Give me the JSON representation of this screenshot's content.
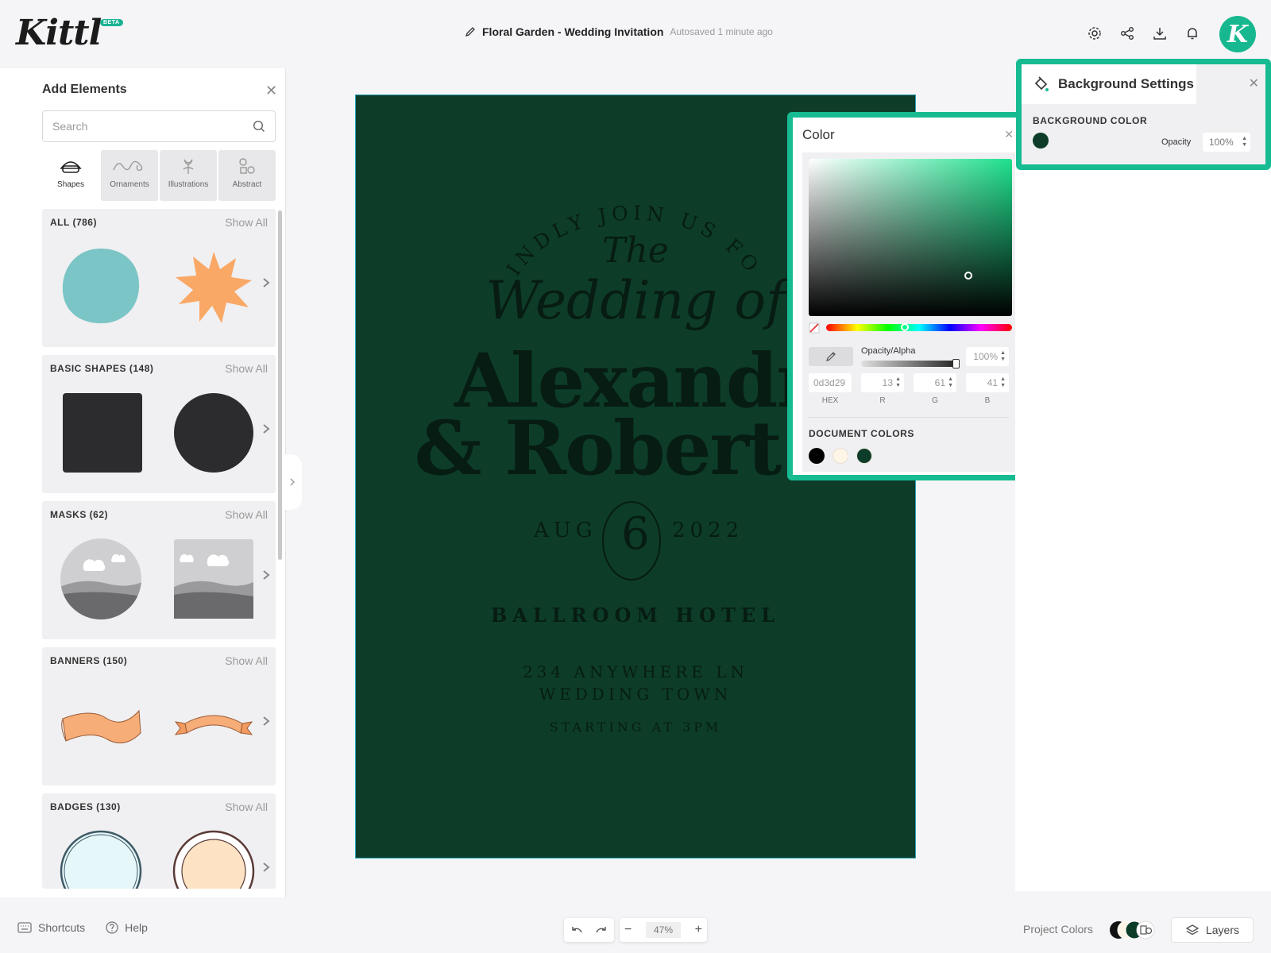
{
  "header": {
    "logo": "Kittl",
    "badge": "BETA",
    "doc_title": "Floral Garden - Wedding Invitation",
    "autosave": "Autosaved 1 minute ago",
    "avatar_letter": "K"
  },
  "left_tools": [
    "edit-icon",
    "layout-icon",
    "text-icon",
    "shapes-icon",
    "upload-icon",
    "camera-icon",
    "pattern-icon"
  ],
  "elements_panel": {
    "title": "Add Elements",
    "search_placeholder": "Search",
    "categories": [
      {
        "label": "Shapes",
        "icon": "shapes-icon",
        "active": true
      },
      {
        "label": "Ornaments",
        "icon": "ornament-icon",
        "active": false
      },
      {
        "label": "Illustrations",
        "icon": "illustration-icon",
        "active": false
      },
      {
        "label": "Abstract",
        "icon": "abstract-icon",
        "active": false
      }
    ],
    "sections": [
      {
        "title": "ALL (786)",
        "show_all": "Show All"
      },
      {
        "title": "BASIC SHAPES (148)",
        "show_all": "Show All"
      },
      {
        "title": "MASKS (62)",
        "show_all": "Show All"
      },
      {
        "title": "BANNERS (150)",
        "show_all": "Show All"
      },
      {
        "title": "BADGES (130)",
        "show_all": "Show All"
      }
    ]
  },
  "invitation": {
    "line1": "KINDLY JOIN US FOR",
    "line2": "The",
    "line3": "Wedding of",
    "name1": "Alexandra",
    "name2": "& Robert",
    "month": "AUG",
    "day": "6",
    "year": "2022",
    "venue": "BALLROOM HOTEL",
    "address1": "234 ANYWHERE LN",
    "address2": "WEDDING TOWN",
    "time": "STARTING AT 3PM",
    "background": "#0d3d29"
  },
  "color_popup": {
    "title": "Color",
    "opacity_label": "Opacity/Alpha",
    "opacity": "100%",
    "hex": "0d3d29",
    "r": "13",
    "g": "61",
    "b": "41",
    "labels": {
      "hex": "HEX",
      "r": "R",
      "g": "G",
      "b": "B"
    },
    "document_colors_label": "DOCUMENT COLORS",
    "document_colors": [
      "#000000",
      "#fff5e6",
      "#0d3d29"
    ]
  },
  "bg_settings": {
    "title": "Background Settings",
    "color_label": "BACKGROUND COLOR",
    "color": "#0d3d29",
    "opacity_label": "Opacity",
    "opacity": "100%"
  },
  "bottom": {
    "shortcuts": "Shortcuts",
    "help": "Help",
    "zoom": "47%",
    "project_colors": "Project Colors",
    "layers": "Layers"
  },
  "accent": "#16bb92"
}
